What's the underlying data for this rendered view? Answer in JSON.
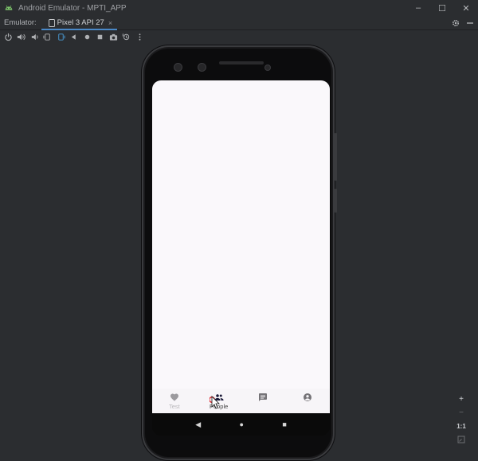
{
  "window": {
    "title": "Android Emulator - MPTI_APP",
    "controls": {
      "minimize": "–",
      "maximize": "☐",
      "close": "✕"
    }
  },
  "tabbar": {
    "label": "Emulator:",
    "tab": {
      "name": "Pixel 3 API 27",
      "close": "×"
    },
    "right_icons": [
      "gear-icon",
      "minimize-panel-icon"
    ]
  },
  "toolbar": {
    "buttons": [
      "power-icon",
      "volume-up-icon",
      "volume-down-icon",
      "rotate-left-icon",
      "rotate-right-icon",
      "back-icon",
      "home-icon",
      "overview-icon",
      "screenshot-icon",
      "snapshot-icon",
      "more-icon"
    ]
  },
  "app": {
    "bottom_nav": [
      {
        "label": "Test",
        "icon": "heart-icon",
        "active": false
      },
      {
        "label": "People",
        "icon": "people-icon",
        "active": true
      },
      {
        "label": "",
        "icon": "chat-icon",
        "active": false
      },
      {
        "label": "",
        "icon": "account-icon",
        "active": false
      }
    ]
  },
  "system_nav": {
    "back": "◀",
    "home": "●",
    "overview": "■"
  },
  "zoom": {
    "zoom_in": "+",
    "zoom_out": "−",
    "ratio": "1:1",
    "fit": "fit-screen-icon"
  },
  "colors": {
    "accent": "#4a88c7",
    "background": "#2b2d30",
    "screen": "#faf8fb"
  }
}
